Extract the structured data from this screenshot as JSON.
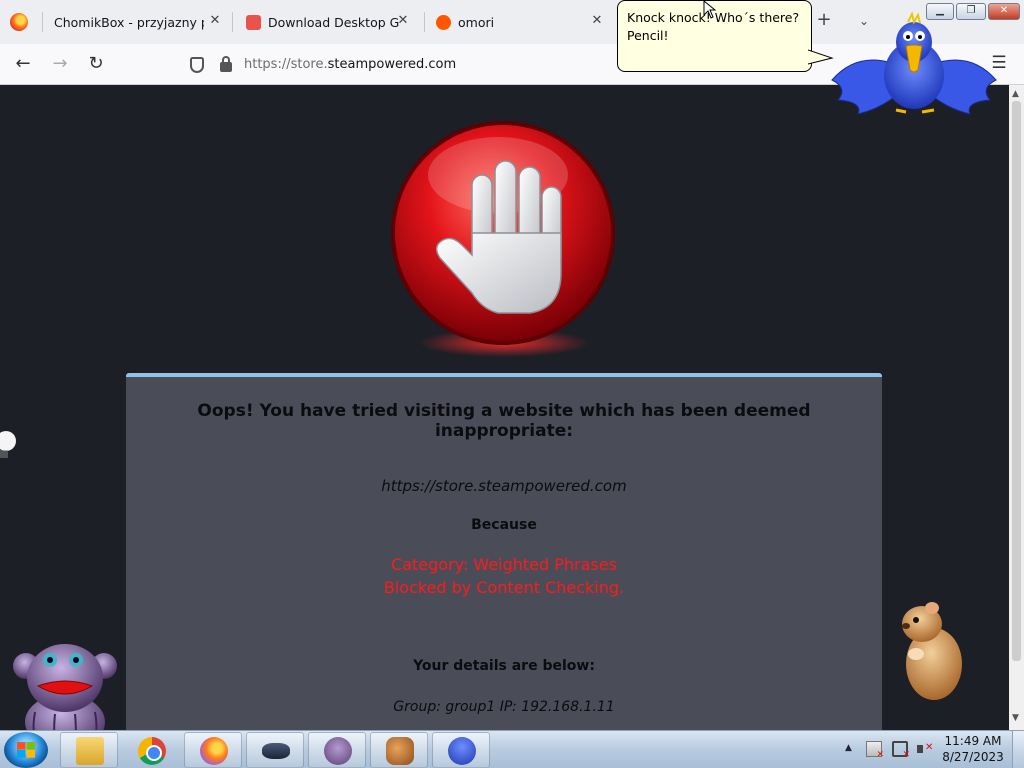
{
  "browser": {
    "tabs": [
      {
        "title": "ChomikBox - przyjazny progr",
        "favicon": "chomikbox-icon"
      },
      {
        "title": "Download Desktop Goose",
        "favicon": "goose-download-icon"
      },
      {
        "title": "omori",
        "favicon": "reddit-icon"
      }
    ],
    "url_prefix": "https://store.",
    "url_domain": "steampowered.com"
  },
  "block_page": {
    "heading": "Oops! You have tried visiting a website which has been deemed inappropriate:",
    "blocked_url": "https://store.steampowered.com",
    "because_label": "Because",
    "reason_line1": "Category: Weighted Phrases",
    "reason_line2": "Blocked by Content Checking.",
    "details_label": "Your details are below:",
    "details_line": "Group: group1   IP: 192.168.1.11"
  },
  "speech_bubble": {
    "line1": "Knock knock! Who´s there?",
    "line2": "Pencil!"
  },
  "taskbar": {
    "items": [
      "explorer-icon",
      "chrome-icon",
      "firefox-icon",
      "ufo-pet-icon",
      "monkey-pet-icon",
      "squirrel-pet-icon",
      "bird-pet-icon"
    ],
    "clock_time": "11:49 AM",
    "clock_date": "8/27/2023"
  },
  "colors": {
    "page_background": "#1d1f26",
    "panel_background": "#4a4d58",
    "panel_accent": "#8fc3ea",
    "reason_red": "#ff1a1a"
  }
}
